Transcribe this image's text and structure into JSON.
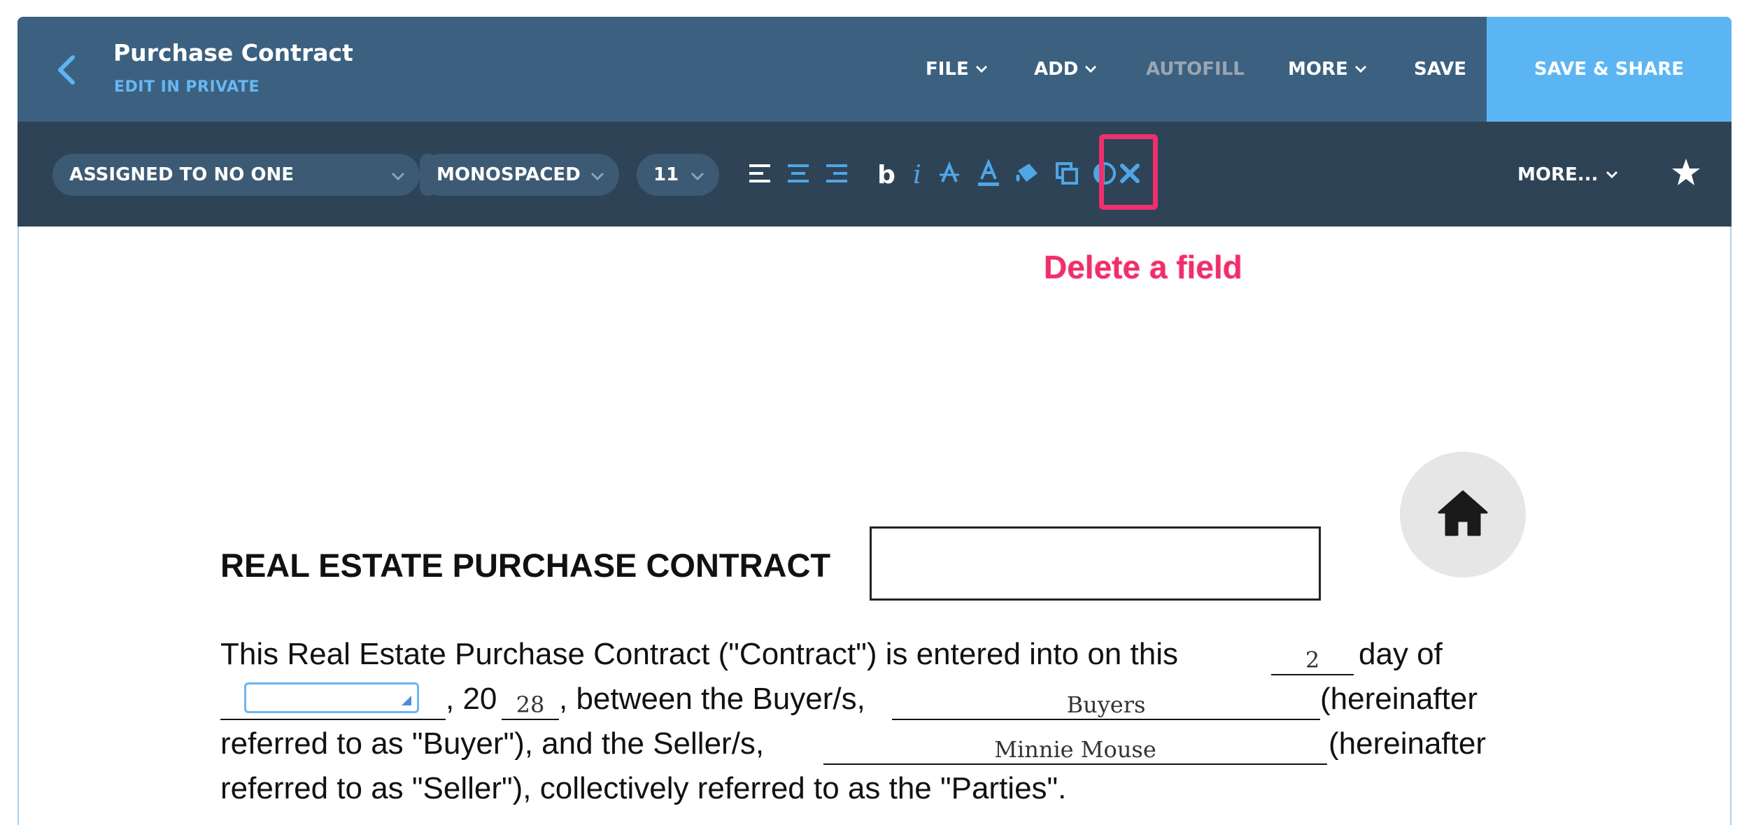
{
  "header": {
    "title": "Purchase Contract",
    "subtitle": "EDIT IN PRIVATE",
    "menu": {
      "file": "FILE",
      "add": "ADD",
      "autofill": "AUTOFILL",
      "more": "MORE",
      "save": "SAVE",
      "save_share": "SAVE & SHARE"
    }
  },
  "toolbar": {
    "assigned": "ASSIGNED TO NO ONE",
    "font": "MONOSPACED",
    "size": "11",
    "more": "MORE...",
    "tools": [
      "align-left-icon",
      "align-center-icon",
      "align-right-icon",
      "bold-icon",
      "italic-icon",
      "strikethrough-icon",
      "text-color-icon",
      "fill-color-icon",
      "duplicate-icon",
      "contrast-icon",
      "delete-field-icon"
    ],
    "bold_glyph": "b",
    "italic_glyph": "i"
  },
  "annotation": "Delete a field",
  "colors": {
    "header_bg": "#3c6180",
    "toolbar_bg": "#2e4456",
    "accent": "#5cb5f3",
    "highlight": "#ef2f6e"
  },
  "document": {
    "title": "REAL ESTATE PURCHASE CONTRACT",
    "lines": {
      "l1a": "This Real Estate Purchase Contract (\"Contract\") is entered into on this",
      "day_value": "2",
      "l1b": "day of",
      "l2a": ", 20",
      "year_value": "28",
      "l2b": ", between the Buyer/s,",
      "buyer_value": "Buyers",
      "l2c": "(hereinafter",
      "l3a": "referred to as \"Buyer\"), and the Seller/s,",
      "seller_value": "Minnie Mouse",
      "l3b": "(hereinafter",
      "l4": "referred to as \"Seller\"), collectively referred to as the \"Parties\"."
    }
  }
}
